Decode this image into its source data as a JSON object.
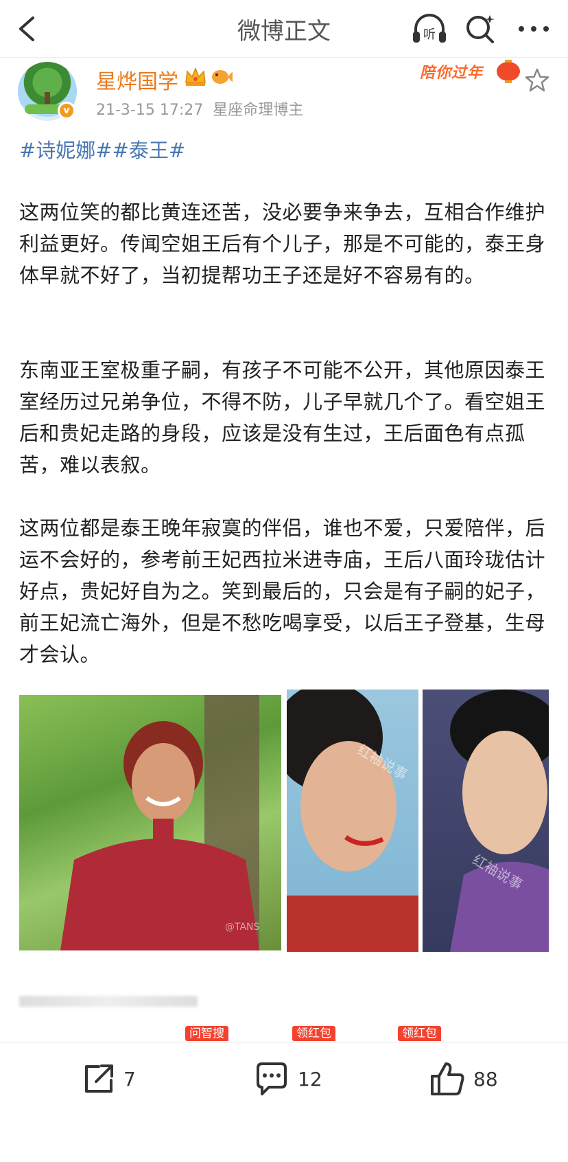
{
  "header": {
    "title": "微博正文",
    "icons": [
      "back-icon",
      "listen-icon",
      "search-icon",
      "more-icon"
    ],
    "listen_label": "听"
  },
  "post": {
    "author": {
      "name": "星烨国学",
      "verified_mark": "v",
      "badges": [
        "crown-icon",
        "fish-icon"
      ]
    },
    "timestamp": "21-3-15 17:27",
    "source": "星座命理博主",
    "promo_banner": "陪你过年",
    "tags": "#诗妮娜##泰王#",
    "paragraphs": [
      "这两位笑的都比黄连还苦，没必要争来争去，互相合作维护利益更好。传闻空姐王后有个儿子，那是不可能的，泰王身体早就不好了，当初提帮功王子还是好不容易有的。",
      "东南亚王室极重子嗣，有孩子不可能不公开，其他原因泰王室经历过兄弟争位，不得不防，儿子早就几个了。看空姐王后和贵妃走路的身段，应该是没有生过，王后面色有点孤苦，难以表叙。",
      "这两位都是泰王晚年寂寞的伴侣，谁也不爱，只爱陪伴，后运不会好的，参考前王妃西拉米进寺庙，王后八面玲珑估计好点，贵妃好自为之。笑到最后的，只会是有子嗣的妃子，前王妃流亡海外，但是不愁吃喝享受，以后王子登基，生母才会认。"
    ],
    "images": [
      {
        "watermark": "@TANS"
      },
      {
        "watermark": "红袖说事"
      },
      {
        "watermark": "红袖说事"
      }
    ],
    "promos": [
      "问智搜",
      "领红包",
      "领红包"
    ]
  },
  "actions": {
    "share_count": "7",
    "comment_count": "12",
    "like_count": "88"
  },
  "colors": {
    "username": "#ea7a1b",
    "tag": "#4a77b3",
    "promo": "#f3422f",
    "verified": "#f39b1e"
  }
}
